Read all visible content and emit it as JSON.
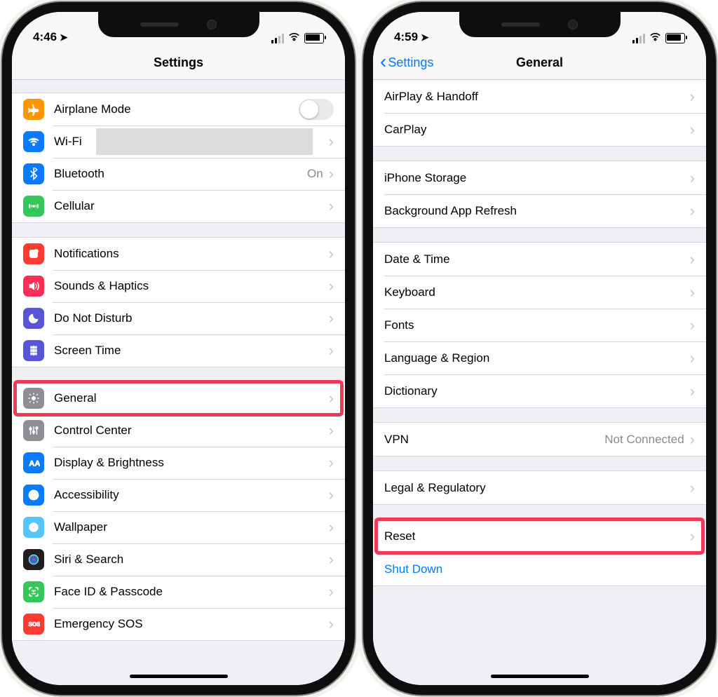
{
  "left": {
    "statusTime": "4:46",
    "title": "Settings",
    "groups": [
      [
        {
          "key": "airplane",
          "icon": "airplane",
          "color": "#ff9500",
          "label": "Airplane Mode",
          "toggle": true
        },
        {
          "key": "wifi",
          "icon": "wifi",
          "color": "#0a7aff",
          "label": "Wi-Fi",
          "redacted": true,
          "chev": true
        },
        {
          "key": "bluetooth",
          "icon": "bluetooth",
          "color": "#0a7aff",
          "label": "Bluetooth",
          "value": "On",
          "chev": true
        },
        {
          "key": "cellular",
          "icon": "cellular",
          "color": "#35c759",
          "label": "Cellular",
          "chev": true
        }
      ],
      [
        {
          "key": "notifications",
          "icon": "notifications",
          "color": "#ff3a30",
          "label": "Notifications",
          "chev": true
        },
        {
          "key": "sounds",
          "icon": "sounds",
          "color": "#ff2d55",
          "label": "Sounds & Haptics",
          "chev": true
        },
        {
          "key": "dnd",
          "icon": "dnd",
          "color": "#5856d6",
          "label": "Do Not Disturb",
          "chev": true
        },
        {
          "key": "screentime",
          "icon": "screentime",
          "color": "#5856d6",
          "label": "Screen Time",
          "chev": true
        }
      ],
      [
        {
          "key": "general",
          "icon": "general",
          "color": "#8e8e93",
          "label": "General",
          "chev": true,
          "highlight": true
        },
        {
          "key": "control-center",
          "icon": "control-center",
          "color": "#8e8e93",
          "label": "Control Center",
          "chev": true
        },
        {
          "key": "display",
          "icon": "display",
          "color": "#0a7aff",
          "label": "Display & Brightness",
          "chev": true
        },
        {
          "key": "accessibility",
          "icon": "accessibility",
          "color": "#0a7aff",
          "label": "Accessibility",
          "chev": true
        },
        {
          "key": "wallpaper",
          "icon": "wallpaper",
          "color": "#54c6fb",
          "label": "Wallpaper",
          "chev": true
        },
        {
          "key": "siri",
          "icon": "siri",
          "color": "#1f1f20",
          "label": "Siri & Search",
          "chev": true
        },
        {
          "key": "faceid",
          "icon": "faceid",
          "color": "#35c759",
          "label": "Face ID & Passcode",
          "chev": true
        },
        {
          "key": "sos",
          "icon": "sos",
          "color": "#ff3a30",
          "label": "Emergency SOS",
          "chev": true
        }
      ]
    ]
  },
  "right": {
    "statusTime": "4:59",
    "backLabel": "Settings",
    "title": "General",
    "groups": [
      [
        {
          "key": "airplay",
          "label": "AirPlay & Handoff",
          "chev": true
        },
        {
          "key": "carplay",
          "label": "CarPlay",
          "chev": true
        }
      ],
      [
        {
          "key": "storage",
          "label": "iPhone Storage",
          "chev": true
        },
        {
          "key": "bgrefresh",
          "label": "Background App Refresh",
          "chev": true
        }
      ],
      [
        {
          "key": "datetime",
          "label": "Date & Time",
          "chev": true
        },
        {
          "key": "keyboard",
          "label": "Keyboard",
          "chev": true
        },
        {
          "key": "fonts",
          "label": "Fonts",
          "chev": true
        },
        {
          "key": "langregion",
          "label": "Language & Region",
          "chev": true
        },
        {
          "key": "dictionary",
          "label": "Dictionary",
          "chev": true
        }
      ],
      [
        {
          "key": "vpn",
          "label": "VPN",
          "value": "Not Connected",
          "chev": true
        }
      ],
      [
        {
          "key": "legal",
          "label": "Legal & Regulatory",
          "chev": true
        }
      ],
      [
        {
          "key": "reset",
          "label": "Reset",
          "chev": true,
          "highlight": true
        },
        {
          "key": "shutdown",
          "label": "Shut Down",
          "blue": true
        }
      ]
    ]
  }
}
